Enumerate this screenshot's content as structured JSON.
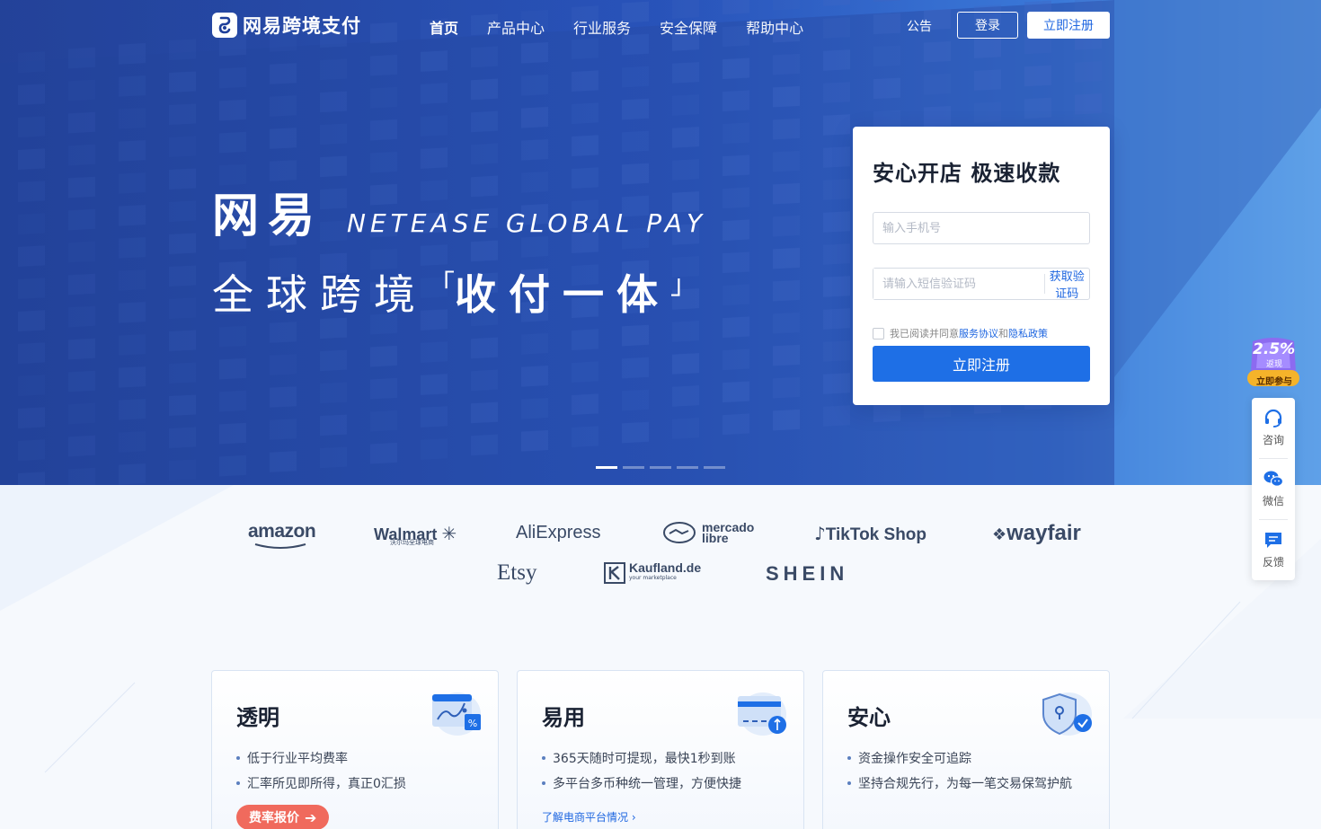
{
  "nav": {
    "logo_text": "网易跨境支付",
    "menu": [
      {
        "label": "首页",
        "active": true
      },
      {
        "label": "产品中心",
        "active": false
      },
      {
        "label": "行业服务",
        "active": false
      },
      {
        "label": "安全保障",
        "active": false
      },
      {
        "label": "帮助中心",
        "active": false
      }
    ],
    "notice": "公告",
    "login": "登录",
    "register": "立即注册"
  },
  "hero": {
    "title_cn": "网易",
    "title_en": "NETEASE GLOBAL PAY",
    "slogan_normal": "全球跨境",
    "slogan_open": "「",
    "slogan_bold": "收付一体",
    "slogan_close": "」",
    "slides": 5,
    "active_slide": 1
  },
  "form": {
    "title": "安心开店 极速收款",
    "phone_placeholder": "输入手机号",
    "code_placeholder": "请输入短信验证码",
    "get_code": "获取验证码",
    "agree_prefix": "我已阅读并同意",
    "agree_terms": "服务协议",
    "agree_and": "和",
    "agree_privacy": "隐私政策",
    "submit": "立即注册"
  },
  "partners": [
    "amazon",
    "Walmart",
    "沃尔玛全球电商",
    "AliExpress",
    "mercado",
    "libre",
    "TikTok Shop",
    "wayfair",
    "Etsy",
    "Kaufland.de",
    "your marketplace",
    "SHEIN"
  ],
  "features": [
    {
      "title": "透明",
      "items": [
        "低于行业平均费率",
        "汇率所见即所得，真正0汇损"
      ],
      "action": "费率报价",
      "icon": "rate-chart-icon"
    },
    {
      "title": "易用",
      "items": [
        "365天随时可提现，最快1秒到账",
        "多平台多币种统一管理，方便快捷"
      ],
      "link": "了解电商平台情况",
      "icon": "card-icon"
    },
    {
      "title": "安心",
      "items": [
        "资金操作安全可追踪",
        "坚持合规先行，为每一笔交易保驾护航"
      ],
      "icon": "shield-icon"
    }
  ],
  "promo": {
    "rate": "2.5%",
    "sub": "返现",
    "cta": "立即参与"
  },
  "side": {
    "consult": "咨询",
    "wechat": "微信",
    "feedback": "反馈"
  },
  "colors": {
    "primary": "#1e6fe6",
    "accent": "#f06a5d",
    "hero": "#2a59c4"
  }
}
